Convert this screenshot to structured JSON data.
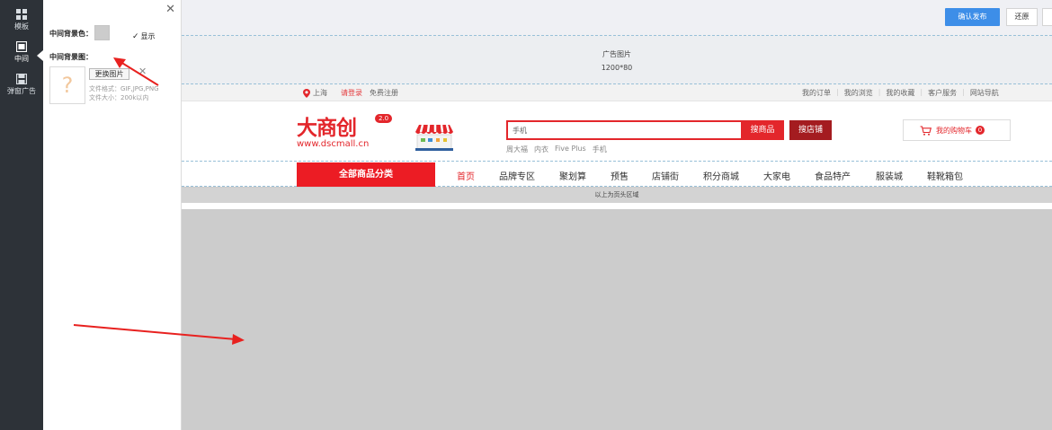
{
  "sidebar": {
    "items": [
      {
        "label": "模板"
      },
      {
        "label": "中间"
      },
      {
        "label": "弹窗广告"
      }
    ]
  },
  "panel": {
    "bg_color_label": "中间背景色：",
    "show_label": "显示",
    "bg_image_label": "中间背景图：",
    "replace_button": "更换图片",
    "hint_format": "文件格式：GIF,JPG,PNG",
    "hint_size": "文件大小：200k以内",
    "swatch_color": "#cccccc"
  },
  "toolbar": {
    "publish_label": "确认发布",
    "restore_label": "还原"
  },
  "ad": {
    "title": "广告图片",
    "size": "1200*80"
  },
  "topbar": {
    "city": "上海",
    "login": "请登录",
    "register": "免费注册",
    "links": [
      "我的订单",
      "我的浏览",
      "我的收藏",
      "客户服务",
      "网站导航"
    ]
  },
  "header": {
    "logo_text": "大商创",
    "logo_badge": "2.0",
    "logo_url": "www.dscmall.cn",
    "search_value": "手机",
    "search_button": "搜商品",
    "shop_button": "搜店铺",
    "hotwords": [
      "周大福",
      "内衣",
      "Five Plus",
      "手机"
    ],
    "cart_label": "我的购物车",
    "cart_count": "0"
  },
  "nav": {
    "all_categories": "全部商品分类",
    "items": [
      "首页",
      "品牌专区",
      "聚划算",
      "预售",
      "店铺街",
      "积分商城",
      "大家电",
      "食品特产",
      "服装城",
      "鞋靴箱包"
    ]
  },
  "tip": "以上为页头区域",
  "colors": {
    "accent": "#e3262b",
    "publish": "#3d8ee8",
    "canvas_bg": "#cccccc",
    "sidebar_bg": "#2d3238"
  }
}
